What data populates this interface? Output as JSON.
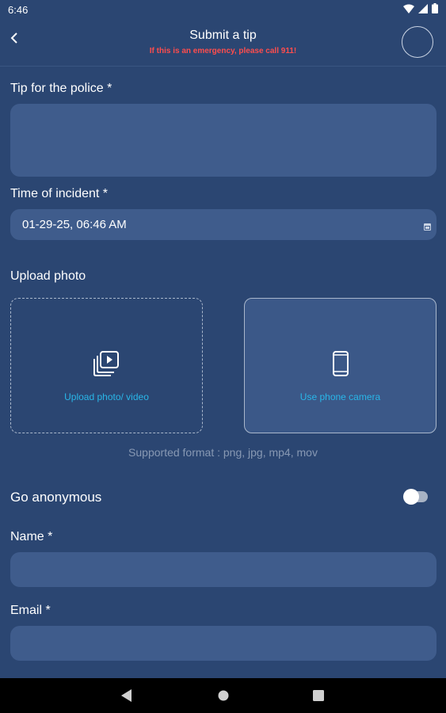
{
  "status": {
    "time": "6:46"
  },
  "header": {
    "title": "Submit a tip",
    "subtitle": "If this is an emergency, please call 911!"
  },
  "form": {
    "tip_label": "Tip for the police *",
    "tip_value": "",
    "time_label": "Time of incident *",
    "time_value": "01-29-25, 06:46 AM",
    "upload_label": "Upload photo",
    "upload_file_label": "Upload photo/ video",
    "camera_label": "Use phone camera",
    "supported_text": "Supported format : png, jpg, mp4, mov",
    "anonymous_label": "Go anonymous",
    "anonymous_on": false,
    "name_label": "Name *",
    "name_value": "",
    "email_label": "Email *",
    "email_value": ""
  },
  "colors": {
    "background": "#2b4672",
    "field": "#3f5c8c",
    "accent": "#29b6e8",
    "warning": "#ff4d4d"
  },
  "icons": {
    "back": "chevron-left-icon",
    "calendar": "calendar-icon",
    "upload": "media-upload-icon",
    "camera": "phone-icon"
  }
}
